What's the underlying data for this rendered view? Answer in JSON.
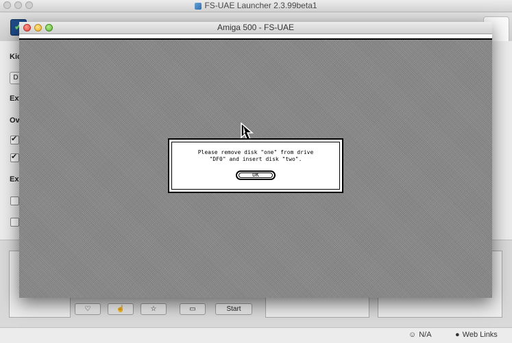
{
  "launcher": {
    "title": "FS-UAE Launcher 2.3.99beta1",
    "left_labels": [
      "Kic",
      "Ext",
      "Ov",
      "Exp"
    ],
    "left_button": "D",
    "bottom_buttons": {
      "start": "Start"
    },
    "status": {
      "network": "N/A",
      "web_links": "Web Links"
    }
  },
  "amiga": {
    "title": "Amiga 500 - FS-UAE",
    "requester": {
      "line1": "Please remove disk \"one\" from drive",
      "line2": "\"DF0\" and insert disk \"two\".",
      "ok_label": "OK"
    }
  },
  "colors": {
    "screen_bg": "#8c8c8c",
    "requester_bg": "#ffffff",
    "requester_border": "#000000"
  }
}
